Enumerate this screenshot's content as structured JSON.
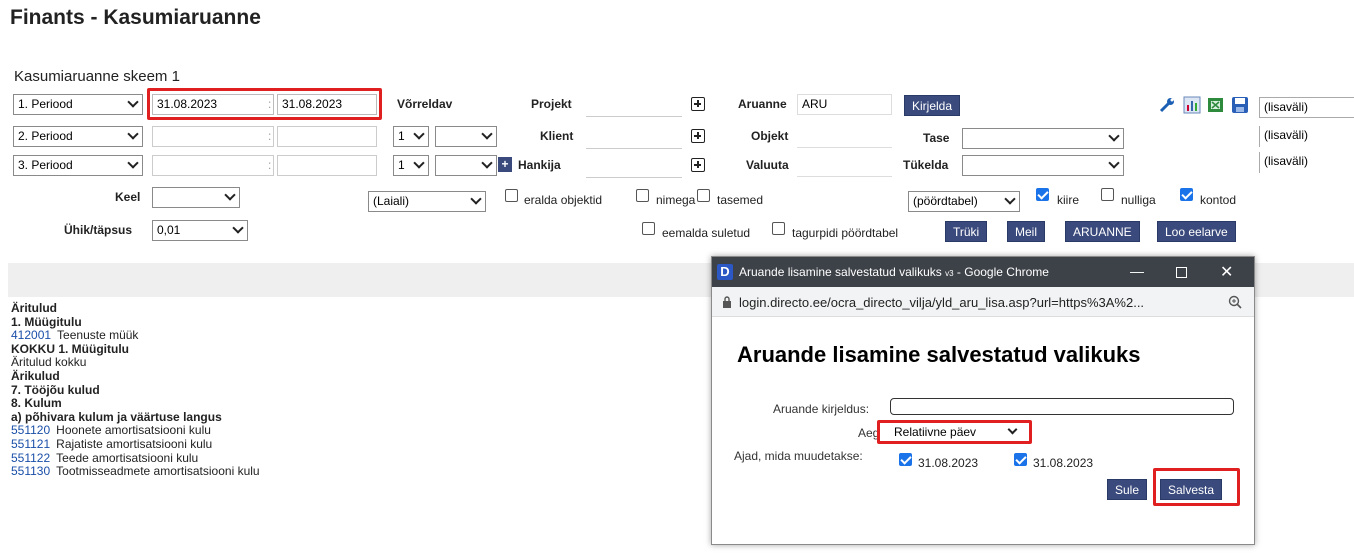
{
  "page_title": "Finants - Kasumiaruanne",
  "schema_title": "Kasumiaruanne skeem 1",
  "periods": [
    {
      "select": "1. Periood",
      "from": "31.08.2023",
      "to": "31.08.2023"
    },
    {
      "select": "2. Periood",
      "from": "",
      "to": ""
    },
    {
      "select": "3. Periood",
      "from": "",
      "to": ""
    }
  ],
  "compare": {
    "label": "Võrreldav",
    "row2_a": "1",
    "row2_b": "",
    "row3_a": "1",
    "row3_b": ""
  },
  "filters": {
    "projekt_label": "Projekt",
    "klient_label": "Klient",
    "hankija_label": "Hankija",
    "aruanne_label": "Aruanne",
    "aruanne_value": "ARU",
    "kirjelda_label": "Kirjelda",
    "objekt_label": "Objekt",
    "valuuta_label": "Valuuta",
    "tase_label": "Tase",
    "tukelda_label": "Tükelda",
    "lisavali": [
      "(lisaväli)",
      "(lisaväli)",
      "(lisaväli)"
    ]
  },
  "options": {
    "keel_label": "Keel",
    "keel_value": "",
    "unit_label": "Ühik/täpsus",
    "unit_value": "0,01",
    "laiali_value": "(Laiali)",
    "eralda_objektid": "eralda objektid",
    "nimega": "nimega",
    "tasemed": "tasemed",
    "pivot_value": "(pöördtabel)",
    "kiire": "kiire",
    "nulliga": "nulliga",
    "kontod": "kontod",
    "eemalda_suletud": "eemalda suletud",
    "tagurpidi": "tagurpidi pöördtabel"
  },
  "buttons": {
    "truki": "Trüki",
    "meil": "Meil",
    "aruanne": "ARUANNE",
    "loo_eelarve": "Loo eelarve"
  },
  "report_rows": [
    {
      "code": "",
      "text": "Äritulud",
      "bold": true
    },
    {
      "code": "",
      "text": "1. Müügitulu",
      "bold": true
    },
    {
      "code": "412001",
      "text": "Teenuste müük",
      "bold": false
    },
    {
      "code": "",
      "text": "KOKKU 1. Müügitulu",
      "bold": true
    },
    {
      "code": "",
      "text": "Äritulud kokku",
      "bold": false
    },
    {
      "code": "",
      "text": "Ärikulud",
      "bold": true
    },
    {
      "code": "",
      "text": "7. Tööjõu kulud",
      "bold": true
    },
    {
      "code": "",
      "text": "8. Kulum",
      "bold": true
    },
    {
      "code": "",
      "text": "a) põhivara kulum ja väärtuse langus",
      "bold": true
    },
    {
      "code": "551120",
      "text": "Hoonete amortisatsiooni kulu",
      "bold": false
    },
    {
      "code": "551121",
      "text": "Rajatiste amortisatsiooni kulu",
      "bold": false
    },
    {
      "code": "551122",
      "text": "Teede amortisatsiooni kulu",
      "bold": false
    },
    {
      "code": "551130",
      "text": "Tootmisseadmete amortisatsiooni kulu",
      "bold": false
    }
  ],
  "dialog": {
    "window_title": "Aruande lisamine salvestatud valikuks",
    "window_subtitle": "v3",
    "window_app": "- Google Chrome",
    "url": "login.directo.ee/ocra_directo_vilja/yld_aru_lisa.asp?url=https%3A%2...",
    "heading": "Aruande lisamine salvestatud valikuks",
    "desc_label": "Aruande kirjeldus:",
    "desc_value": "",
    "aeg_label": "Aeg",
    "aeg_value": "Relatiivne päev",
    "ajad_label": "Ajad, mida muudetakse:",
    "date1": "31.08.2023",
    "date2": "31.08.2023",
    "sule": "Sule",
    "salvesta": "Salvesta"
  },
  "colors": {
    "button_bg": "#3a4a7c",
    "highlight": "#e02020",
    "link": "#1a4fa8",
    "check": "#1a73e8"
  }
}
